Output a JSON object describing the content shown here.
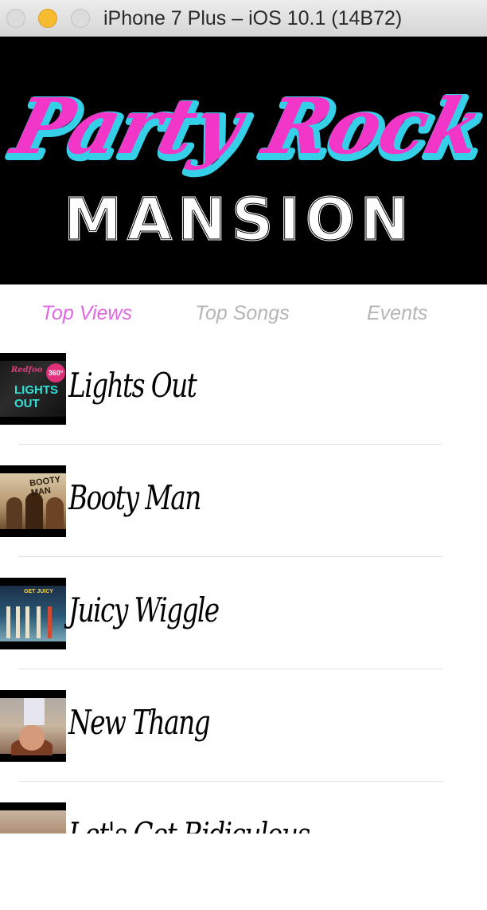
{
  "window": {
    "title": "iPhone 7 Plus – iOS 10.1 (14B72)"
  },
  "banner": {
    "line1": "Party Rock",
    "line2": "MANSION",
    "colors": {
      "script_fill": "#f236c8",
      "script_outline": "#35d0e8",
      "block_fill": "#ffffff",
      "background": "#000000"
    }
  },
  "tabs": [
    {
      "label": "Top Views",
      "active": true
    },
    {
      "label": "Top Songs",
      "active": false
    },
    {
      "label": "Events",
      "active": false
    }
  ],
  "theme": {
    "active_tab_color": "#e067df",
    "inactive_tab_color": "#b5b5b5"
  },
  "songs": [
    {
      "title": "Lights Out",
      "thumb_text": "LIGHTS OUT",
      "thumb_badge": "360°",
      "thumb_brand": "Redfoo"
    },
    {
      "title": "Booty Man",
      "thumb_text": "BOOTY MAN"
    },
    {
      "title": "Juicy Wiggle",
      "thumb_text": "GET JUICY"
    },
    {
      "title": "New Thang"
    },
    {
      "title": "Let's Get Ridiculous"
    }
  ]
}
